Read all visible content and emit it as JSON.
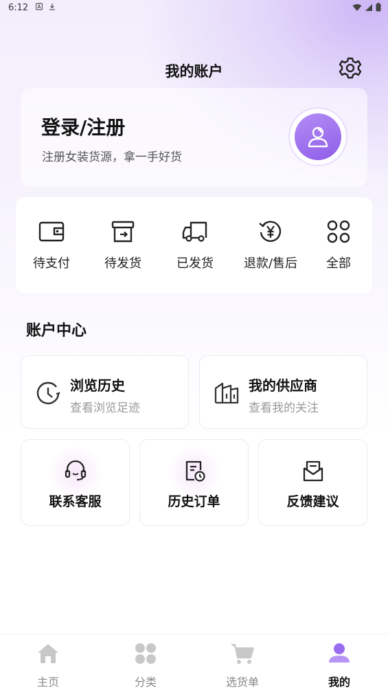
{
  "status_bar": {
    "time": "6:12"
  },
  "header": {
    "title": "我的账户"
  },
  "login": {
    "title": "登录/注册",
    "subtitle": "注册女装货源，拿一手好货"
  },
  "orders": [
    {
      "label": "待支付",
      "icon": "wallet-icon"
    },
    {
      "label": "待发货",
      "icon": "box-icon"
    },
    {
      "label": "已发货",
      "icon": "truck-icon"
    },
    {
      "label": "退款/售后",
      "icon": "refund-icon"
    },
    {
      "label": "全部",
      "icon": "grid-icon"
    }
  ],
  "account_center": {
    "title": "账户中心",
    "big_cards": [
      {
        "title": "浏览历史",
        "subtitle": "查看浏览足迹",
        "icon": "clock-icon"
      },
      {
        "title": "我的供应商",
        "subtitle": "查看我的关注",
        "icon": "store-icon"
      }
    ],
    "small_cards": [
      {
        "label": "联系客服",
        "icon": "headset-icon"
      },
      {
        "label": "历史订单",
        "icon": "order-history-icon"
      },
      {
        "label": "反馈建议",
        "icon": "feedback-icon"
      }
    ]
  },
  "nav": [
    {
      "label": "主页",
      "icon": "home-icon"
    },
    {
      "label": "分类",
      "icon": "category-icon"
    },
    {
      "label": "选货单",
      "icon": "cart-icon"
    },
    {
      "label": "我的",
      "icon": "user-icon",
      "active": true
    }
  ],
  "colors": {
    "accent": "#9b6cf0",
    "nav_inactive": "#c8c8c8",
    "text_muted": "#999999"
  }
}
